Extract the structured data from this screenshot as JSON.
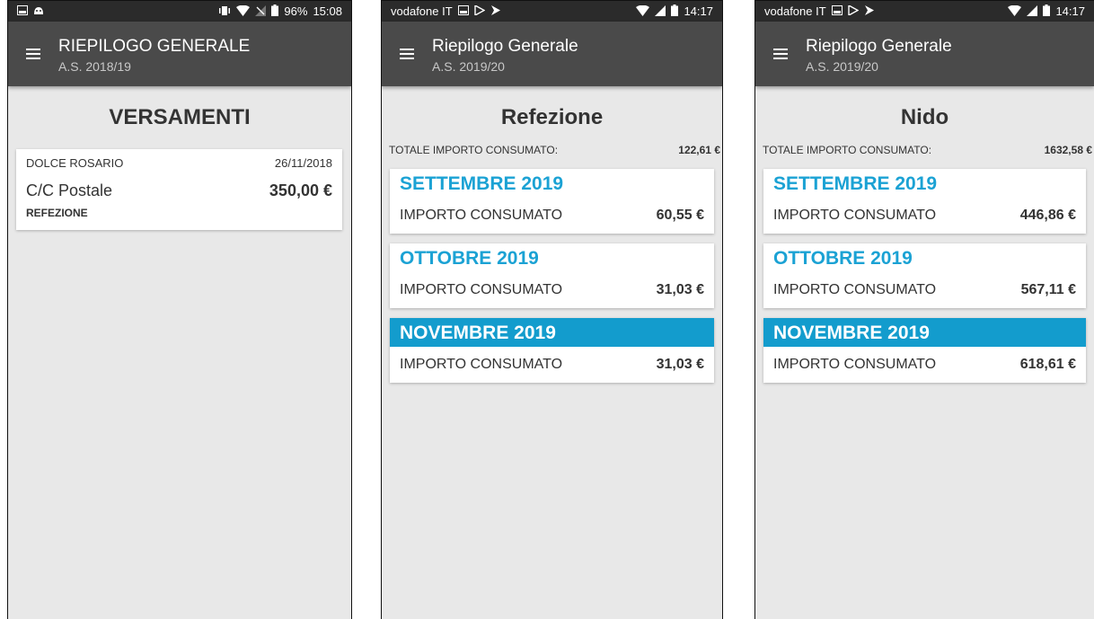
{
  "colors": {
    "statusbar": "#2b2b2b",
    "appbar": "#4a4a4a",
    "background": "#e8e8e8",
    "accent": "#1ba2d4",
    "selected": "#139ccd"
  },
  "screens": [
    {
      "status": {
        "left_icons": [
          "image-icon",
          "android-icon"
        ],
        "right_icons": [
          "vibrate-icon",
          "wifi-icon",
          "no-signal-icon",
          "battery-icon"
        ],
        "battery": "96%",
        "time": "15:08"
      },
      "appbar": {
        "title": "RIEPILOGO GENERALE",
        "subtitle": "A.S. 2018/19"
      },
      "heading": "VERSAMENTI",
      "payment": {
        "name": "DOLCE ROSARIO",
        "date": "26/11/2018",
        "method": "C/C Postale",
        "amount": "350,00 €",
        "category": "REFEZIONE"
      }
    },
    {
      "status": {
        "carrier": "vodafone IT",
        "left_icons": [
          "image-icon",
          "play-icon",
          "play-store-icon"
        ],
        "right_icons": [
          "wifi-icon",
          "signal-icon",
          "battery-icon"
        ],
        "time": "14:17"
      },
      "appbar": {
        "title": "Riepilogo Generale",
        "subtitle": "A.S. 2019/20"
      },
      "heading": "Refezione",
      "total_label": "TOTALE IMPORTO CONSUMATO:",
      "total_value": "122,61 €",
      "months": [
        {
          "name": "SETTEMBRE 2019",
          "label": "IMPORTO CONSUMATO",
          "amount": "60,55 €",
          "selected": false
        },
        {
          "name": "OTTOBRE 2019",
          "label": "IMPORTO CONSUMATO",
          "amount": "31,03 €",
          "selected": false
        },
        {
          "name": "NOVEMBRE 2019",
          "label": "IMPORTO CONSUMATO",
          "amount": "31,03 €",
          "selected": true
        }
      ]
    },
    {
      "status": {
        "carrier": "vodafone IT",
        "left_icons": [
          "image-icon",
          "play-icon",
          "play-store-icon"
        ],
        "right_icons": [
          "wifi-icon",
          "signal-icon",
          "battery-icon"
        ],
        "time": "14:17"
      },
      "appbar": {
        "title": "Riepilogo Generale",
        "subtitle": "A.S. 2019/20"
      },
      "heading": "Nido",
      "total_label": "TOTALE IMPORTO CONSUMATO:",
      "total_value": "1632,58 €",
      "months": [
        {
          "name": "SETTEMBRE 2019",
          "label": "IMPORTO CONSUMATO",
          "amount": "446,86 €",
          "selected": false
        },
        {
          "name": "OTTOBRE 2019",
          "label": "IMPORTO CONSUMATO",
          "amount": "567,11 €",
          "selected": false
        },
        {
          "name": "NOVEMBRE 2019",
          "label": "IMPORTO CONSUMATO",
          "amount": "618,61 €",
          "selected": true
        }
      ]
    }
  ]
}
